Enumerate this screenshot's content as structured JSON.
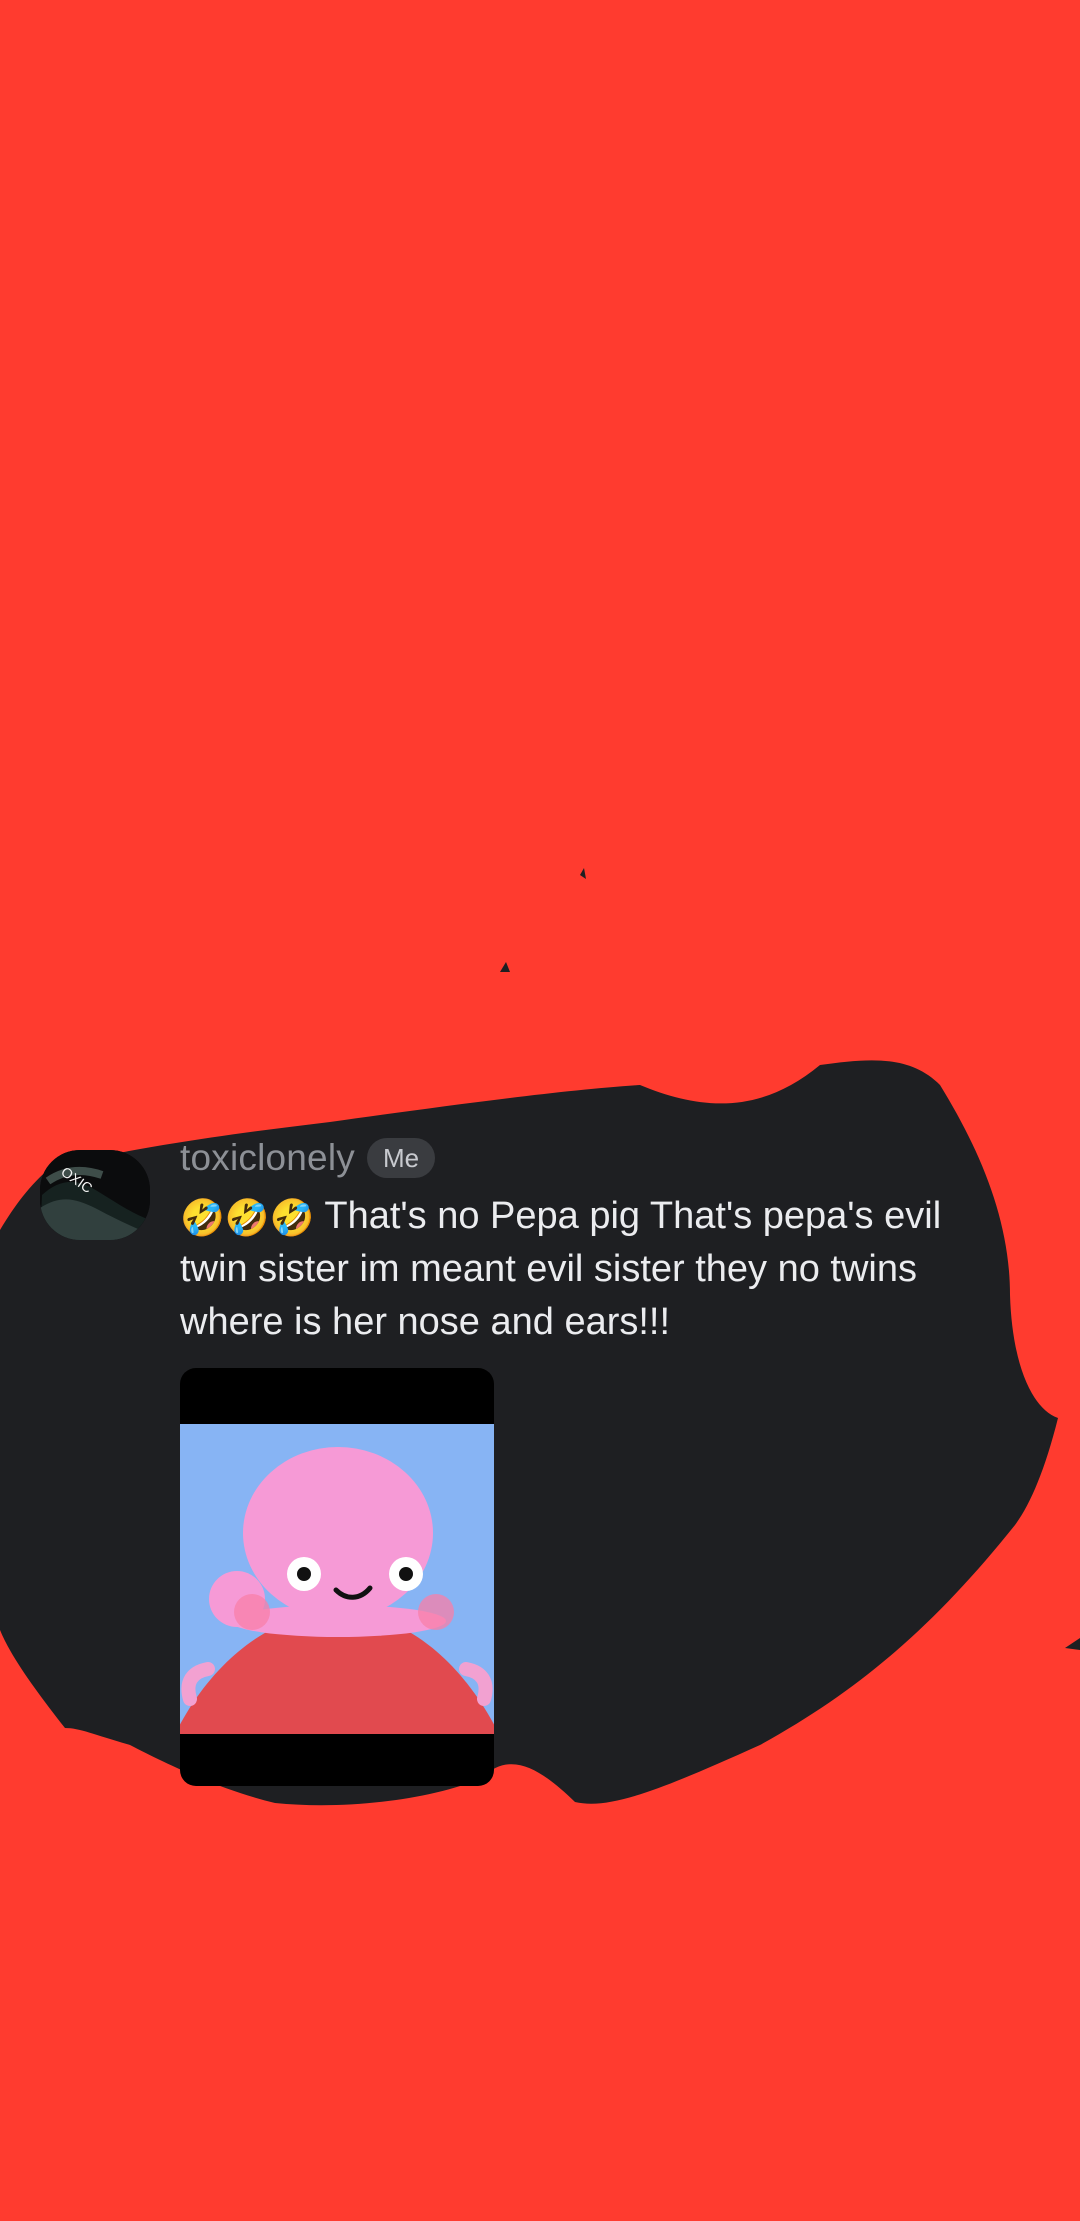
{
  "message": {
    "author": "toxiclonely",
    "badge": "Me",
    "emojis": "🤣🤣🤣",
    "text": "That's no Pepa pig That's pepa's evil twin sister im meant evil sister they no twins where is her nose and ears!!!"
  },
  "avatar": {
    "text": "OXIC"
  },
  "colors": {
    "scribble": "#ff3b2f",
    "message_background": "#1e1f22",
    "attachment_sky": "#87b4f4",
    "attachment_pig": "#f59ad4",
    "attachment_dress": "#e14a4f"
  },
  "icons": {
    "avatar_image": "avatar-icon",
    "attachment_image": "image-icon"
  }
}
